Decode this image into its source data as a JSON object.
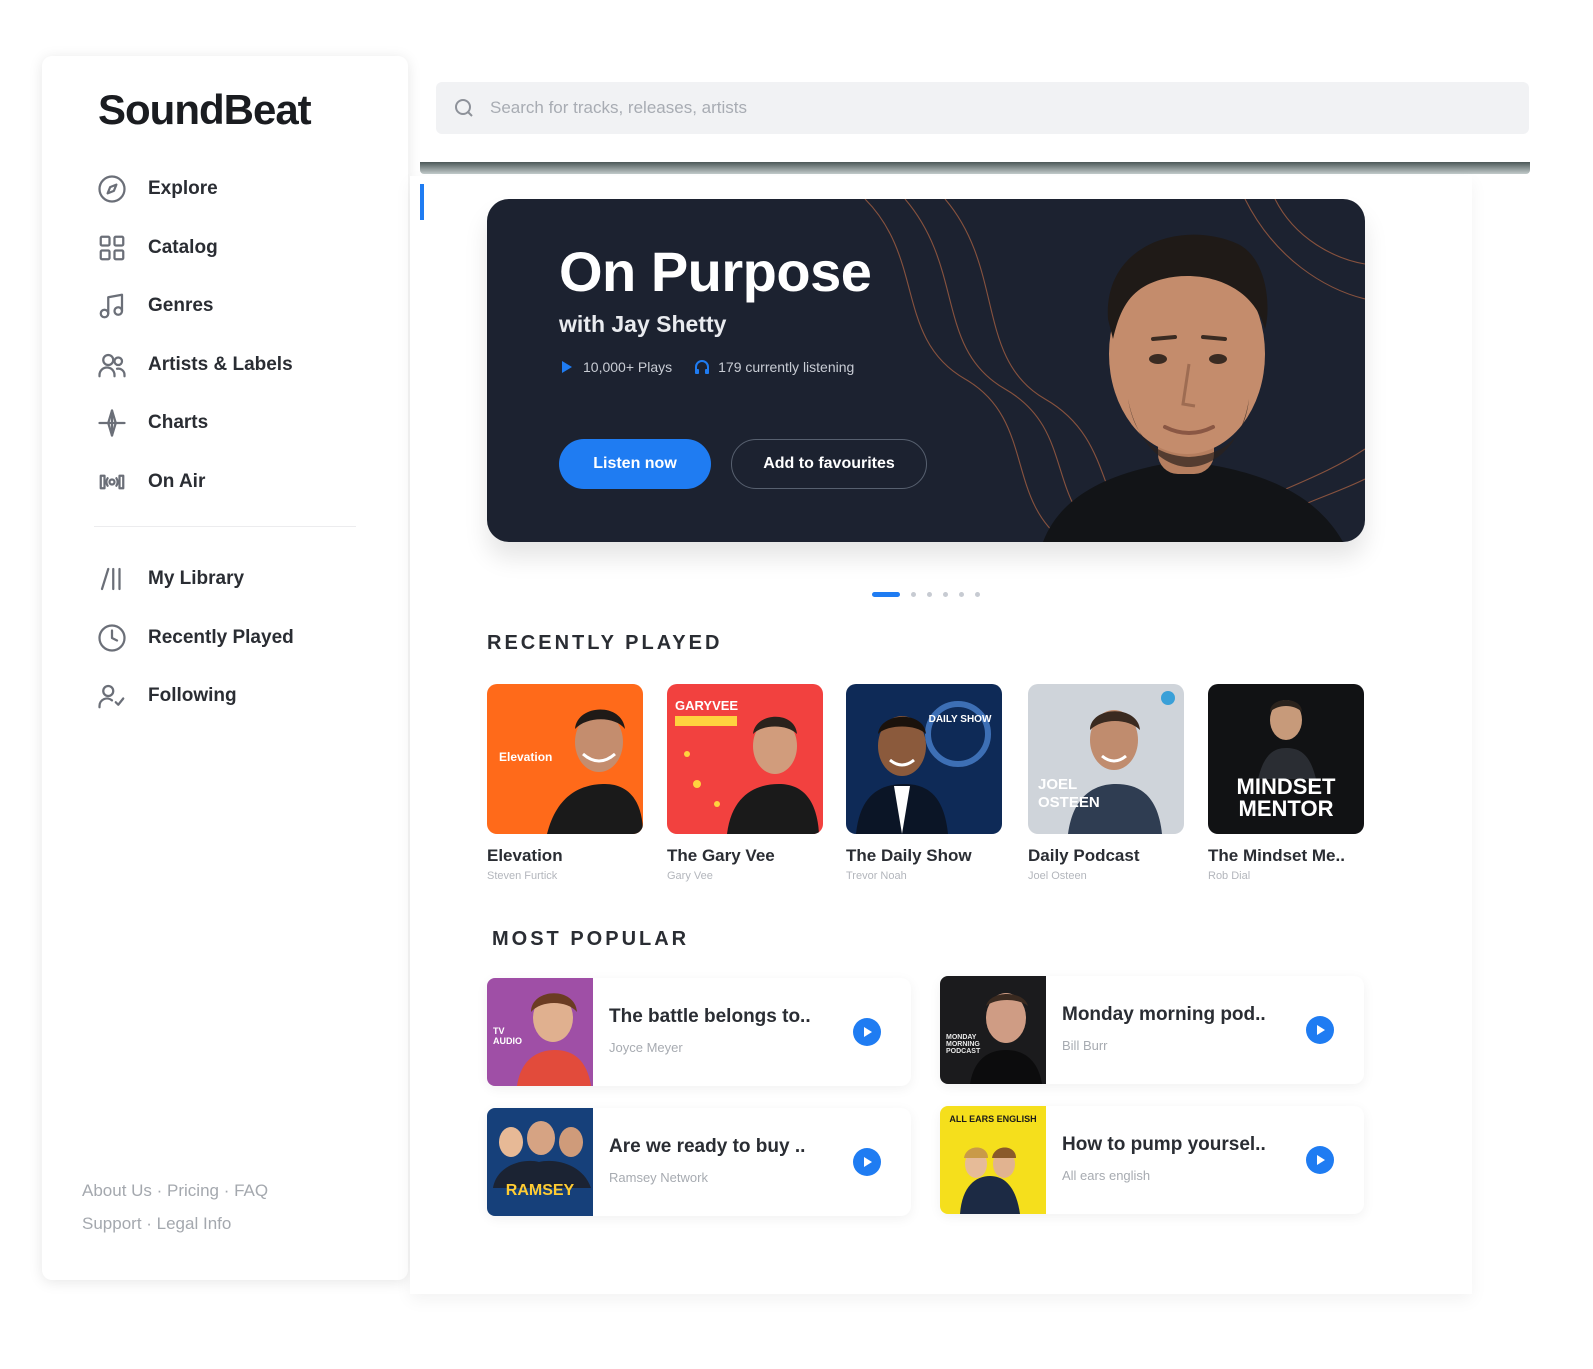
{
  "app": {
    "brand": "SoundBeat",
    "accent": "#1f7cf2"
  },
  "search": {
    "placeholder": "Search for tracks, releases, artists"
  },
  "sidebar": {
    "nav": [
      {
        "label": "Explore",
        "icon": "compass-icon"
      },
      {
        "label": "Catalog",
        "icon": "grid-icon"
      },
      {
        "label": "Genres",
        "icon": "music-note-icon"
      },
      {
        "label": "Artists & Labels",
        "icon": "users-icon"
      },
      {
        "label": "Charts",
        "icon": "chart-icon"
      },
      {
        "label": "On Air",
        "icon": "broadcast-icon"
      }
    ],
    "library": [
      {
        "label": "My Library",
        "icon": "library-icon"
      },
      {
        "label": "Recently Played",
        "icon": "clock-icon"
      },
      {
        "label": "Following",
        "icon": "user-check-icon"
      }
    ],
    "footer": {
      "line1": "About Us · Pricing · FAQ",
      "line2": "Support · Legal Info"
    }
  },
  "hero": {
    "title": "On Purpose",
    "subtitle": "with Jay Shetty",
    "plays": "10,000+ Plays",
    "listening": "179 currently listening",
    "primary_button": "Listen now",
    "secondary_button": "Add to favourites",
    "slides_total": 6,
    "slide_active": 1
  },
  "recently_played": {
    "title": "RECENTLY PLAYED",
    "items": [
      {
        "title": "Elevation",
        "author": "Steven Furtick",
        "cover_label": "Elevation",
        "cover_color": "#ff6a1a"
      },
      {
        "title": "The Gary Vee",
        "author": "Gary Vee",
        "cover_label": "GARYVEE",
        "cover_color": "#f2413f"
      },
      {
        "title": "The Daily Show",
        "author": "Trevor Noah",
        "cover_label": "DAILY SHOW",
        "cover_color": "#0e2a57"
      },
      {
        "title": "Daily Podcast",
        "author": "Joel Osteen",
        "cover_label": "JOEL OSTEEN",
        "cover_color": "#cfd4da"
      },
      {
        "title": "The Mindset Me..",
        "author": "Rob Dial",
        "cover_label": "MINDSET MENTOR",
        "cover_color": "#111214"
      }
    ]
  },
  "most_popular": {
    "title": "MOST POPULAR",
    "items": [
      {
        "title": "The battle belongs to..",
        "author": "Joyce Meyer",
        "thumb_color": "#9f4fa6",
        "thumb_label": "TV AUDIO"
      },
      {
        "title": "Monday morning pod..",
        "author": "Bill Burr",
        "thumb_color": "#1b1b1d",
        "thumb_label": "MONDAY MORNING PODCAST"
      },
      {
        "title": "Are we ready to buy ..",
        "author": "Ramsey Network",
        "thumb_color": "#16407a",
        "thumb_label": "RAMSEY"
      },
      {
        "title": "How to pump yoursel..",
        "author": "All ears english",
        "thumb_color": "#f5df1c",
        "thumb_label": "ALL EARS ENGLISH"
      }
    ]
  }
}
